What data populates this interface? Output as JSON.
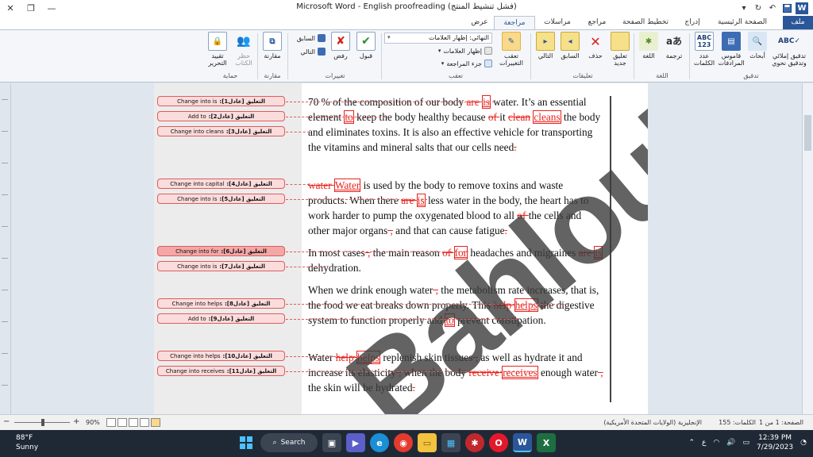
{
  "window": {
    "title": "Microsoft Word  -  English proofreading (فشل تنشيط المنتج)",
    "minimize_glyph": "—",
    "restore_glyph": "❐",
    "close_glyph": "✕"
  },
  "tabs": [
    {
      "label": "ملف",
      "active": false
    },
    {
      "label": "الصفحة الرئيسية",
      "active": false
    },
    {
      "label": "إدراج",
      "active": false
    },
    {
      "label": "تخطيط الصفحة",
      "active": false
    },
    {
      "label": "مراجع",
      "active": false
    },
    {
      "label": "مراسلات",
      "active": false
    },
    {
      "label": "مراجعة",
      "active": true
    },
    {
      "label": "عرض",
      "active": false
    }
  ],
  "ribbon": {
    "proofing": {
      "group_label": "تدقيق",
      "spelling": "تدقيق إملائي وتدقيق نحوي",
      "research": "أبحاث",
      "thesaurus": "قاموس المرادفات",
      "word_count": "عدد الكلمات"
    },
    "language": {
      "group_label": "اللغة",
      "translate": "ترجمة",
      "language": "اللغة"
    },
    "comments": {
      "group_label": "تعليقات",
      "new_comment": "تعليق جديد",
      "delete": "حذف",
      "previous": "السابق",
      "next": "التالي"
    },
    "tracking": {
      "group_label": "تعقب",
      "track_changes": "تعقب التغييرات",
      "display_for_review": "النهائي: إظهار العلامات",
      "show_markup": "إظهار العلامات",
      "reviewing_pane": "جزء المراجعة"
    },
    "changes": {
      "group_label": "تغييرات",
      "accept": "قبول",
      "reject": "رفض",
      "previous": "السابق",
      "next": "التالي"
    },
    "compare": {
      "group_label": "مقارنة",
      "compare": "مقارنة"
    },
    "protect": {
      "group_label": "حماية",
      "block_authors": "حظر الكتاب",
      "restrict_editing": "تقييد التحرير"
    }
  },
  "comments": [
    {
      "author": "التعليق [عادل1]:",
      "text": "Change into is"
    },
    {
      "author": "التعليق [عادل2]:",
      "text": "Add to"
    },
    {
      "author": "التعليق [عادل3]:",
      "text": "Change into cleans"
    },
    {
      "author": "التعليق [عادل4]:",
      "text": "Change into capital"
    },
    {
      "author": "التعليق [عادل5]:",
      "text": "Change into is"
    },
    {
      "author": "التعليق [عادل6]:",
      "text": "Change into for"
    },
    {
      "author": "التعليق [عادل7]:",
      "text": "Change into is"
    },
    {
      "author": "التعليق [عادل8]:",
      "text": "Change into helps"
    },
    {
      "author": "التعليق [عادل9]:",
      "text": "Add to"
    },
    {
      "author": "التعليق [عادل10]:",
      "text": "Change into helps"
    },
    {
      "author": "التعليق [عادل11]:",
      "text": "Change into receives"
    }
  ],
  "document": {
    "p1": {
      "a": "70 % of the composition of our body ",
      "del1": "are ",
      "ins1": "is",
      "b": " water. It’s an essential element ",
      "ins2": "to",
      "c": "  keep the body healthy because ",
      "del2": "of ",
      "d": " it ",
      "del3": "clean",
      "e": " ",
      "ins3": "cleans",
      "f": " the body and eliminates toxins. It is also an effective vehicle for transporting the vitamins and mineral salts that our cells need",
      "del4": "."
    },
    "p2": {
      "del1": "water ",
      "ins1": "Water",
      "a": " is used by the body to remove toxins and waste products. When there ",
      "del2": "are ",
      "ins2": "is",
      "b": " less water in the body, the heart has to work harder to pump the oxygenated blood to all ",
      "del3": "of ",
      "c": " the cells and other major organs",
      "del4": " ,",
      "d": " and that can cause fatigue",
      "del5": "."
    },
    "p3": {
      "a": "In most cases",
      "del1": " ,",
      "b": " the main reason ",
      "del2": "of ",
      "ins1": "for",
      "c": " headaches and migraines ",
      "del3": "are ",
      "ins2": "is",
      "d": " dehydration."
    },
    "p4": {
      "a": "When we drink enough water",
      "del1": " ,",
      "b": " the metabolism rate increases, that is, the food we eat breaks down properly. This ",
      "del2": "help ",
      "ins1": "helps",
      "c": " the digestive system to function properly and ",
      "ins2": "to",
      "d": "  prevent constipation."
    },
    "p5": {
      "a": "Water ",
      "del1": "help ",
      "ins1": "helps",
      "b": "  replenish skin tissues",
      "del2": " ,",
      "c": " as well as hydrate it and increase its elasticity",
      "del3": " ,",
      "d": " when the body ",
      "del4": "receive ",
      "ins2": "receives",
      "e": " enough water",
      "del5": " ,",
      "f": " the skin will be hydrated",
      "del6": "."
    }
  },
  "watermark": "Bahloul",
  "statusbar": {
    "page": "الصفحة: 1 من 1",
    "words": "الكلمات: 155",
    "language": "الإنجليزية (الولايات المتحدة الأمريكية)",
    "zoom": "90%",
    "zoom_minus": "−",
    "zoom_plus": "+"
  },
  "taskbar": {
    "temp": "88°F",
    "condition": "Sunny",
    "search_label": "Search",
    "ime": "ع",
    "time": "12:39 PM",
    "date": "7/29/2023"
  }
}
